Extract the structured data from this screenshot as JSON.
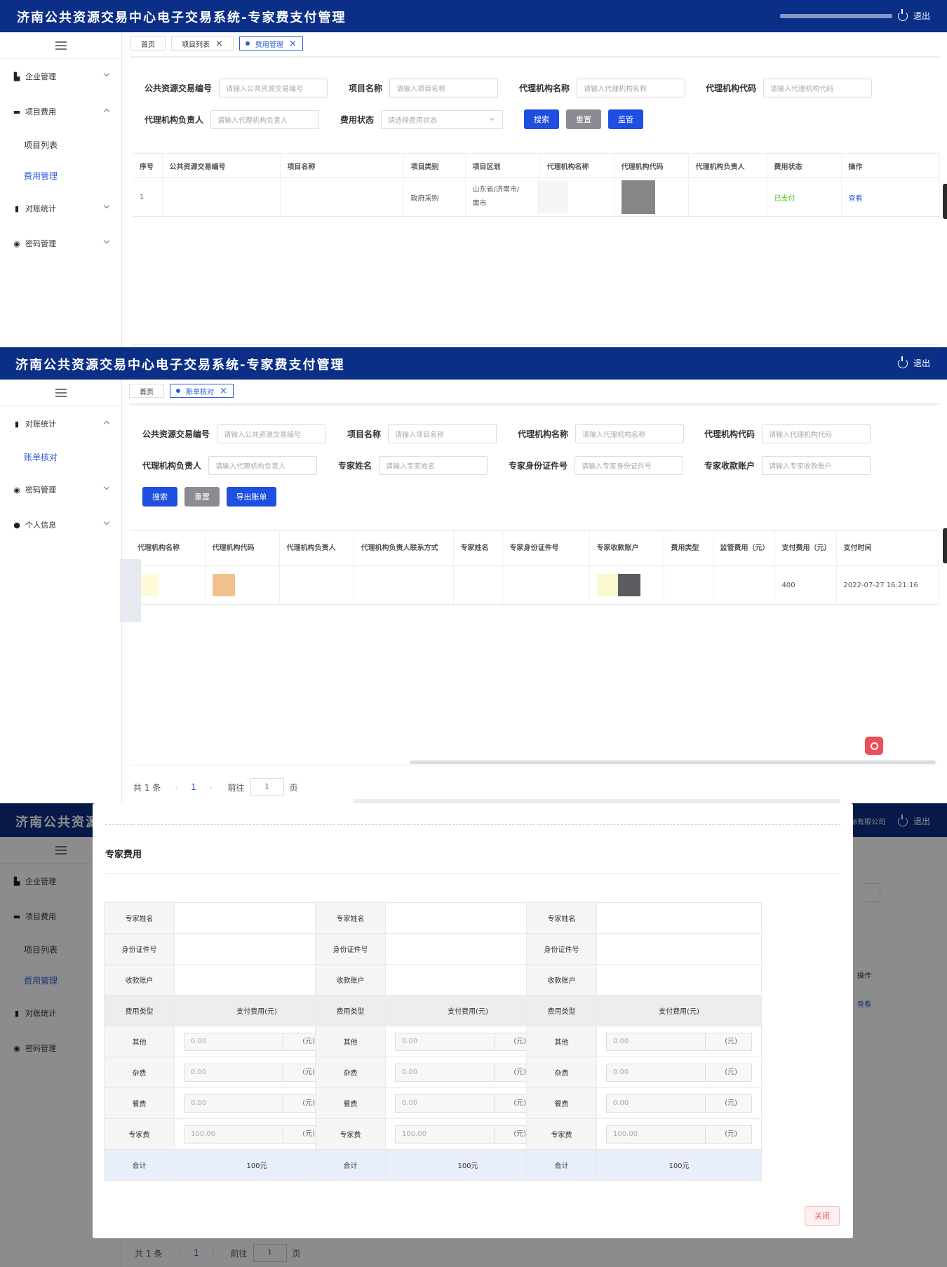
{
  "app_title": "济南公共资源交易中心电子交易系统-专家费支付管理",
  "logout": "退出",
  "company_fragment": "招标有限公司",
  "panel1": {
    "menu": [
      {
        "icon": "building-icon",
        "glyph": "▙",
        "label": "企业管理",
        "expanded": false
      },
      {
        "icon": "monitor-icon",
        "glyph": "▬",
        "label": "项目费用",
        "expanded": true
      }
    ],
    "submenu": [
      {
        "label": "项目列表",
        "active": false
      },
      {
        "label": "费用管理",
        "active": true
      }
    ],
    "menu_after": [
      {
        "icon": "bar-chart-icon",
        "glyph": "▮",
        "label": "对账统计",
        "expanded": false
      },
      {
        "icon": "password-icon",
        "glyph": "◉",
        "label": "密码管理",
        "expanded": false
      }
    ],
    "tabs": [
      "首页",
      "项目列表",
      "费用管理"
    ],
    "filters": {
      "trade_no_label": "公共资源交易编号",
      "trade_no_ph": "请输入公共资源交易编号",
      "project_label": "项目名称",
      "project_ph": "请输入项目名称",
      "agency_label": "代理机构名称",
      "agency_ph": "请输入代理机构名称",
      "code_label": "代理机构代码",
      "code_ph": "请输入代理机构代码",
      "person_label": "代理机构负责人",
      "person_ph": "请输入代理机构负责人",
      "status_label": "费用状态",
      "status_ph": "请选择费用状态"
    },
    "buttons": {
      "search": "搜索",
      "reset": "重置",
      "supervise": "监管"
    },
    "columns": [
      "序号",
      "公共资源交易编号",
      "项目名称",
      "项目类别",
      "项目区划",
      "代理机构名称",
      "代理机构代码",
      "代理机构负责人",
      "费用状态",
      "操作"
    ],
    "row": {
      "index": "1",
      "category": "政府采购",
      "region": "山东省/济南市/",
      "region2": "南市",
      "status": "已支付",
      "action": "查看"
    },
    "colors": {
      "paid": "#52c41a",
      "link": "#2d5bd9"
    }
  },
  "panel2": {
    "menu": [
      {
        "icon": "bar-chart-icon",
        "glyph": "▮",
        "label": "对账统计",
        "expanded": true
      }
    ],
    "submenu": [
      {
        "label": "账单核对",
        "active": true
      }
    ],
    "menu_after": [
      {
        "icon": "password-icon",
        "glyph": "◉",
        "label": "密码管理",
        "expanded": false
      },
      {
        "icon": "user-icon",
        "glyph": "●",
        "label": "个人信息",
        "expanded": false
      }
    ],
    "tabs": [
      "首页",
      "账单核对"
    ],
    "filters": {
      "trade_no_label": "公共资源交易编号",
      "trade_no_ph": "请输入公共资源交易编号",
      "project_label": "项目名称",
      "project_ph": "请输入项目名称",
      "agency_label": "代理机构名称",
      "agency_ph": "请输入代理机构名称",
      "code_label": "代理机构代码",
      "code_ph": "请输入代理机构代码",
      "person_label": "代理机构负责人",
      "person_ph": "请输入代理机构负责人",
      "expert_label": "专家姓名",
      "expert_ph": "请输入专家姓名",
      "idno_label": "专家身份证件号",
      "idno_ph": "请输入专家身份证件号",
      "account_label": "专家收款账户",
      "account_ph": "请输入专家收款账户"
    },
    "buttons": {
      "search": "搜索",
      "reset": "重置",
      "export": "导出账单"
    },
    "columns": [
      "代理机构名称",
      "代理机构代码",
      "代理机构负责人",
      "代理机构负责人联系方式",
      "专家姓名",
      "专家身份证件号",
      "专家收款账户",
      "费用类型",
      "监管费用（元）",
      "支付费用（元）",
      "支付时间"
    ],
    "row": {
      "pay": "400",
      "time": "2022-07-27 16:21:16"
    },
    "pagination": {
      "total": "共 1 条",
      "page": "1",
      "goto": "前往",
      "goto_val": "1",
      "unit": "页"
    }
  },
  "panel3": {
    "bg_menu": [
      {
        "glyph": "▙",
        "label": "企业管理"
      },
      {
        "glyph": "▬",
        "label": "项目费用"
      }
    ],
    "bg_sub": [
      "项目列表",
      "费用管理"
    ],
    "bg_menu_after": [
      {
        "glyph": "▮",
        "label": "对账统计"
      },
      {
        "glyph": "◉",
        "label": "密码管理"
      }
    ],
    "bg_op": "操作",
    "bg_view": "查看",
    "bg_pagination": {
      "total": "共 1 条",
      "page": "1",
      "goto": "前往",
      "goto_val": "1",
      "unit": "页"
    },
    "modal_title": "专家费用",
    "card": {
      "name_label": "专家姓名",
      "id_label": "身份证件号",
      "account_label": "收款账户",
      "type_header": "费用类型",
      "pay_header": "支付费用(元)",
      "rows": [
        {
          "type": "其他",
          "value": "0.00",
          "unit": "(元)"
        },
        {
          "type": "杂费",
          "value": "0.00",
          "unit": "(元)"
        },
        {
          "type": "餐费",
          "value": "0.00",
          "unit": "(元)"
        },
        {
          "type": "专家费",
          "value": "100.00",
          "unit": "(元)"
        }
      ],
      "total_label": "合计",
      "total_value": "100元"
    },
    "card_count": 3,
    "close": "关闭"
  }
}
